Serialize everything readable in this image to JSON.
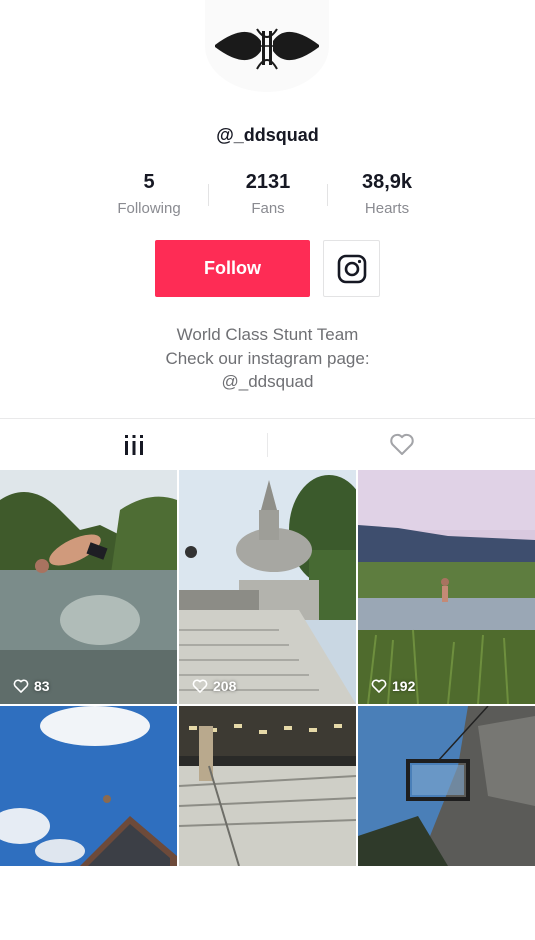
{
  "profile": {
    "username": "@_ddsquad",
    "stats": [
      {
        "value": "5",
        "label": "Following"
      },
      {
        "value": "2131",
        "label": "Fans"
      },
      {
        "value": "38,9k",
        "label": "Hearts"
      }
    ],
    "follow_label": "Follow",
    "bio": [
      "World Class Stunt Team",
      "Check our instagram page:",
      "@_ddsquad"
    ]
  },
  "tabs": [
    {
      "name": "videos-tab",
      "icon": "grid-icon"
    },
    {
      "name": "liked-tab",
      "icon": "heart-outline-icon"
    }
  ],
  "videos": [
    {
      "likes": "83"
    },
    {
      "likes": "208"
    },
    {
      "likes": "192"
    },
    {
      "likes": ""
    },
    {
      "likes": ""
    },
    {
      "likes": ""
    }
  ],
  "colors": {
    "accent": "#fe2c55",
    "text_primary": "#161823",
    "text_secondary": "#8a8b91",
    "divider": "#e3e3e4"
  }
}
